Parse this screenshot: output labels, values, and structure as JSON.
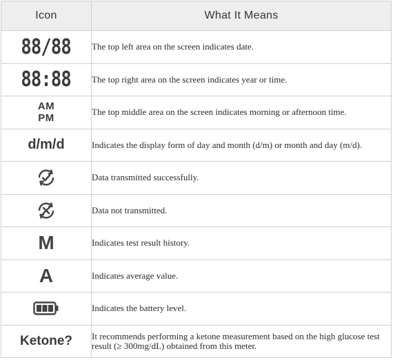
{
  "header": {
    "icon_col": "Icon",
    "meaning_col": "What It Means"
  },
  "rows": [
    {
      "icon_text": "88/88",
      "icon": "seven-segment-date",
      "meaning": "The top left area on the screen indicates date."
    },
    {
      "icon_text": "88:88",
      "icon": "seven-segment-time",
      "meaning": "The top right area on the screen indicates year or time."
    },
    {
      "icon_text_1": "AM",
      "icon_text_2": "PM",
      "icon": "am-pm",
      "meaning": "The top middle area on the screen indicates morning or afternoon time."
    },
    {
      "icon_text": "d/m/d",
      "icon": "date-format",
      "meaning": "Indicates the display form of day and month (d/m) or month and day (m/d)."
    },
    {
      "icon": "transmit-success-icon",
      "meaning": "Data transmitted successfully."
    },
    {
      "icon": "transmit-fail-icon",
      "meaning": "Data not transmitted."
    },
    {
      "icon_text": "M",
      "icon": "memory-letter",
      "meaning": "Indicates test result history."
    },
    {
      "icon_text": "A",
      "icon": "average-letter",
      "meaning": "Indicates average value."
    },
    {
      "icon": "battery-icon",
      "meaning": "Indicates the battery level."
    },
    {
      "icon_text": "Ketone?",
      "icon": "ketone-text",
      "meaning": "It recommends performing a ketone measurement based on the high glucose test result (≥ 300mg/dL) obtained from this meter."
    }
  ]
}
